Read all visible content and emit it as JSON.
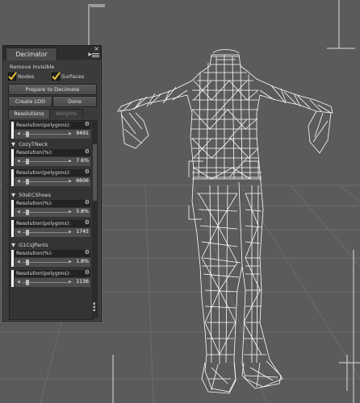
{
  "panel": {
    "tab_title": "Decimator",
    "close_glyph": "×",
    "remove_invisible_label": "Remove Invisible",
    "nodes_label": "Nodes",
    "surfaces_label": "Surfaces",
    "nodes_checked": true,
    "surfaces_checked": true,
    "prepare_button": "Prepare to Decimate",
    "create_lod_button": "Create LOD",
    "done_button": "Done",
    "tabs": [
      "Resolutions",
      "Weights"
    ],
    "active_tab": "Resolutions"
  },
  "resolutions": {
    "first": {
      "label": "Resolution(polygons):",
      "value": "9491"
    },
    "groups": [
      {
        "name": "CozyTNeck",
        "percent": {
          "label": "Resolution(%):",
          "value": "7.6%"
        },
        "polygons": {
          "label": "Resolution(polygons):",
          "value": "6606"
        }
      },
      {
        "name": "50sECShoes",
        "percent": {
          "label": "Resolution(%):",
          "value": "5.8%"
        },
        "polygons": {
          "label": "Resolution(polygons):",
          "value": "1745"
        }
      },
      {
        "name": "G1CsJPants",
        "percent": {
          "label": "Resolution(%):",
          "value": "1.8%"
        },
        "polygons": {
          "label": "Resolution(polygons):",
          "value": "1136"
        }
      }
    ]
  },
  "icons": [
    "checkmark-icon",
    "gear-icon",
    "close-icon",
    "menu-icon",
    "arrow-left-icon",
    "arrow-right-icon",
    "expand-triangle-icon"
  ],
  "colors": {
    "viewport_bg": "#5b5b5b",
    "panel_bg": "#3b3b3b",
    "checkbox_yellow": "#e8c23a",
    "mesh": "#ffffff"
  }
}
